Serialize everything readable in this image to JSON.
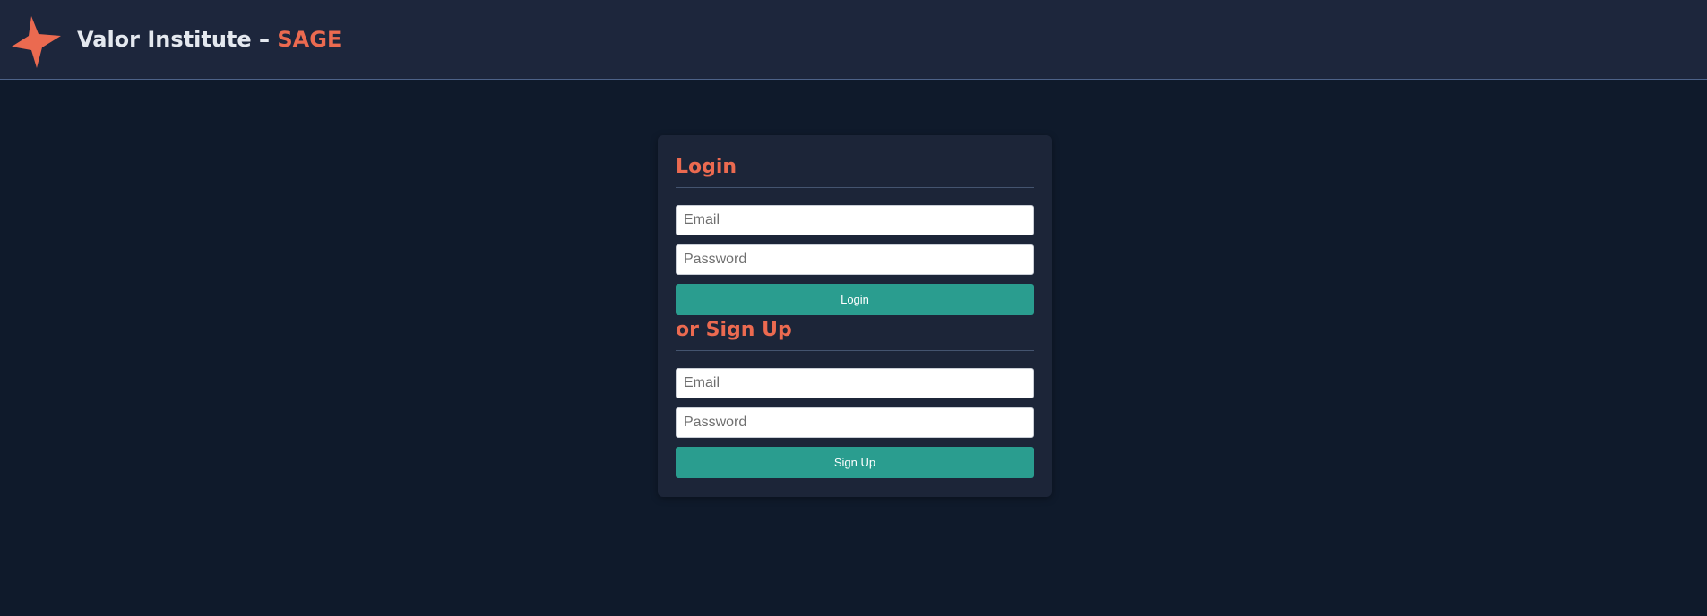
{
  "header": {
    "brand_main": "Valor Institute – ",
    "brand_accent": "SAGE",
    "logo_icon": "star-icon",
    "accent_color": "#eb6a50"
  },
  "login": {
    "title": "Login",
    "email_placeholder": "Email",
    "password_placeholder": "Password",
    "button_label": "Login"
  },
  "signup": {
    "title": "or Sign Up",
    "email_placeholder": "Email",
    "password_placeholder": "Password",
    "button_label": "Sign Up"
  },
  "colors": {
    "background": "#0f1a2b",
    "header_bg": "#1d263c",
    "card_bg": "#1c2538",
    "button": "#2a9d8f"
  }
}
